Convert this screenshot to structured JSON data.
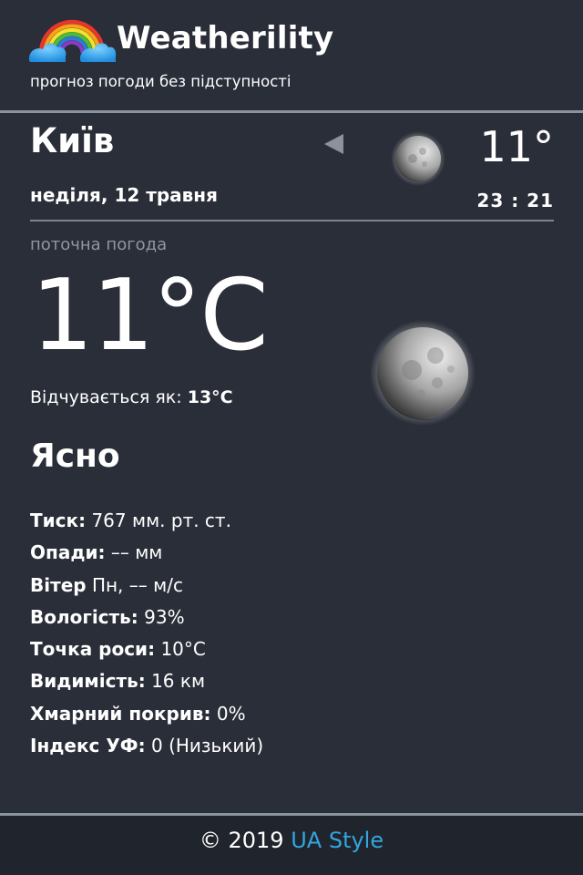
{
  "header": {
    "title": "Weatherility",
    "subtitle": "прогноз погоди без підступності",
    "logo_icon": "rainbow-cloud-icon"
  },
  "location": {
    "city": "Київ",
    "date": "неділя, 12 травня",
    "temperature": "11°",
    "time": "23 : 21",
    "prev_icon": "triangle-left-icon",
    "weather_icon": "moon-icon"
  },
  "current": {
    "label": "поточна погода",
    "temperature": "11°C",
    "feels_label": "Відчувається як:",
    "feels_value": "13°C",
    "condition": "Ясно",
    "weather_icon": "moon-icon"
  },
  "details": [
    {
      "key": "Тиск:",
      "value": "767 мм. рт. ст."
    },
    {
      "key": "Опади:",
      "value": "–– мм"
    },
    {
      "key": "Вітер",
      "value": "Пн, –– м/с"
    },
    {
      "key": "Вологість:",
      "value": "93%"
    },
    {
      "key": "Точка роси:",
      "value": "10°C"
    },
    {
      "key": "Видимість:",
      "value": "16 км"
    },
    {
      "key": "Хмарний покрив:",
      "value": "0%"
    },
    {
      "key": "Індекс УФ:",
      "value": "0 (Низький)"
    }
  ],
  "footer": {
    "prefix": "© 2019",
    "link": "UA Style"
  },
  "colors": {
    "background": "#2a2e38",
    "footer_background": "#20242c",
    "muted_text": "#8f979f",
    "divider": "#8a949c",
    "link": "#33a6df"
  }
}
